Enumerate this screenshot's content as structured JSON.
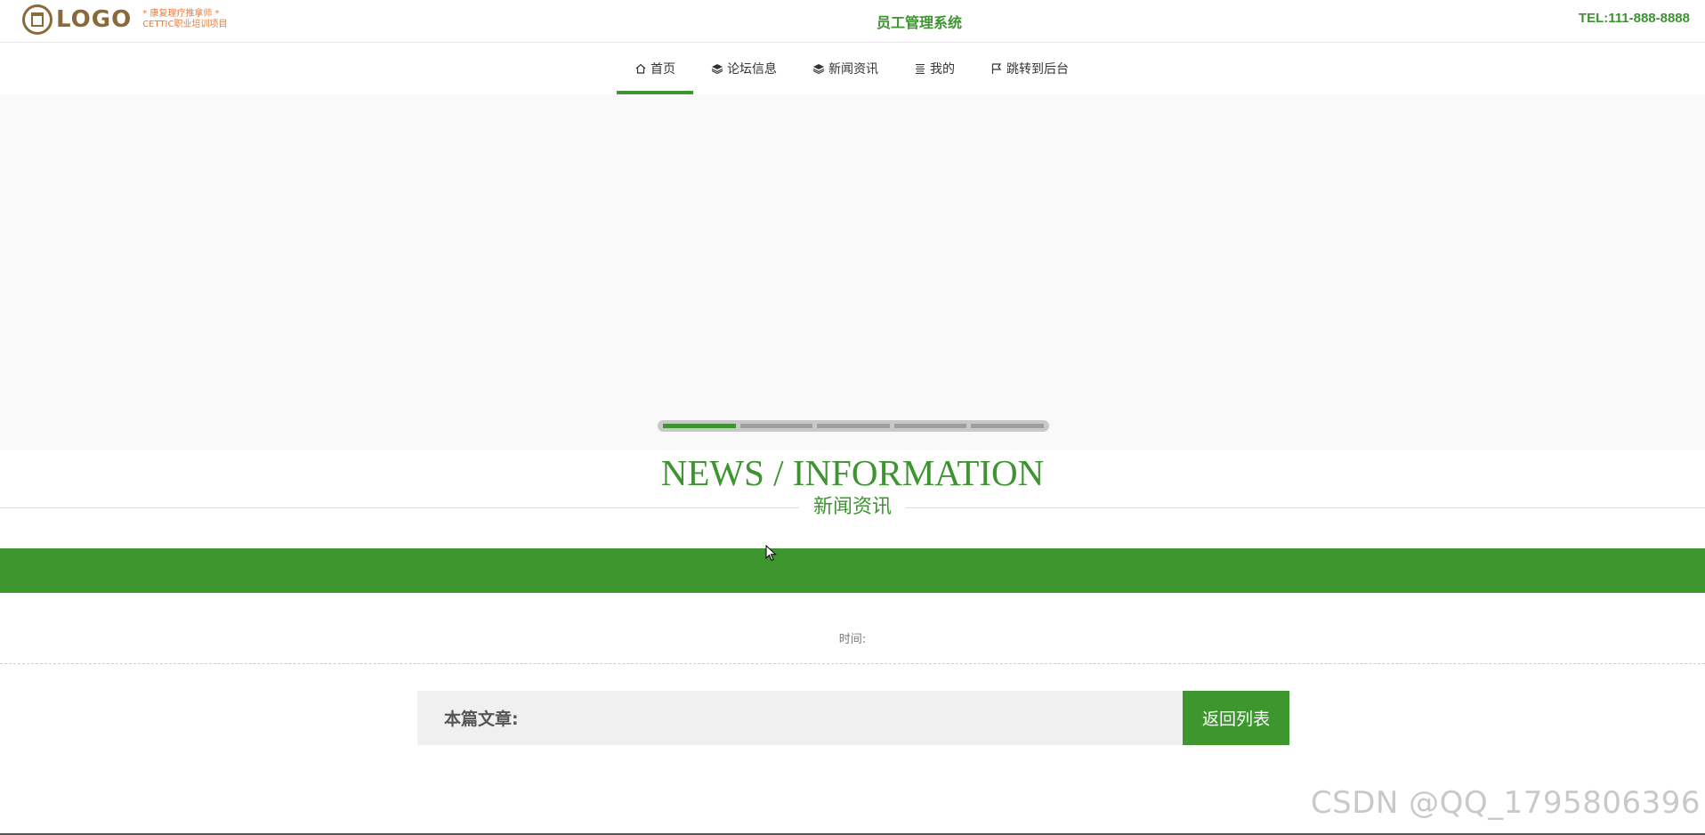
{
  "header": {
    "logo_text": "LOGO",
    "logo_sub_line1": "* 康复理疗推拿师 *",
    "logo_sub_line2": "CETTIC职业培训项目",
    "system_title": "员工管理系统",
    "tel": "TEL:111-888-8888"
  },
  "nav": {
    "items": [
      {
        "label": "首页",
        "icon": "home-icon",
        "active": true
      },
      {
        "label": "论坛信息",
        "icon": "layers-icon"
      },
      {
        "label": "新闻资讯",
        "icon": "layers-icon"
      },
      {
        "label": "我的",
        "icon": "list-icon"
      },
      {
        "label": "跳转到后台",
        "icon": "flag-icon"
      }
    ]
  },
  "banner": {
    "slide_count": 5,
    "active_slide": 1
  },
  "section": {
    "title_en": "NEWS / INFORMATION",
    "title_cn": "新闻资讯"
  },
  "article": {
    "time_label": "时间:",
    "current_label": "本篇文章:",
    "back_button": "返回列表"
  },
  "watermark": "CSDN @QQ_1795806396",
  "colors": {
    "accent": "#3d962e",
    "logo_brown": "#8a6a3a",
    "logo_orange": "#e87c3e"
  }
}
